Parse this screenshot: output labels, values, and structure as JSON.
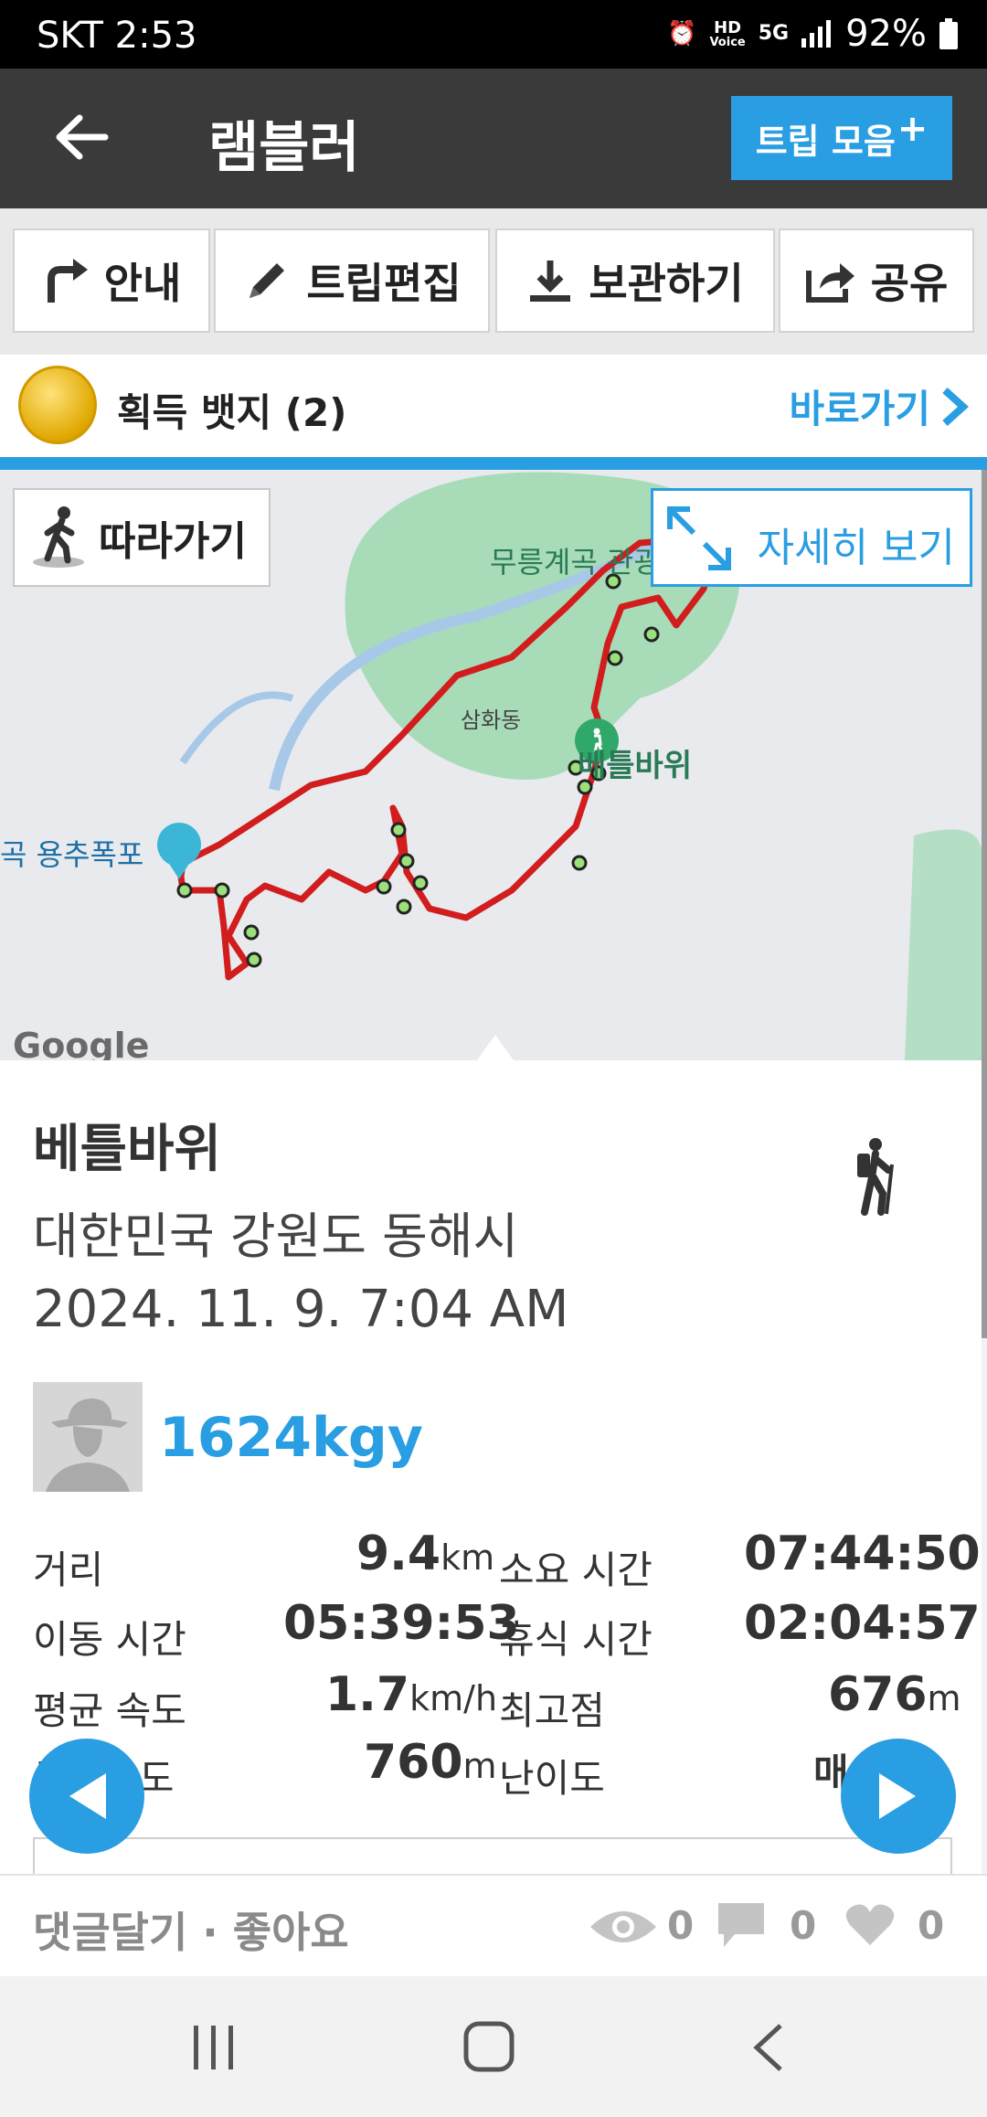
{
  "status_bar": {
    "carrier_time": "SKT 2:53",
    "battery": "92%",
    "hd_label": "HD",
    "voice_label": "Voice",
    "network": "5G"
  },
  "app_bar": {
    "title": "램블러",
    "trip_collection_label": "트립 모음",
    "trip_collection_plus": "+"
  },
  "toolbar": {
    "guide": "안내",
    "edit_trip": "트립편집",
    "save": "보관하기",
    "share": "공유"
  },
  "badges": {
    "label": "획득 뱃지 (2)",
    "goto_label": "바로가기"
  },
  "map": {
    "follow_label": "따라가기",
    "detail_label": "자세히 보기",
    "place_valley": "무릉계곡 관광",
    "place_village": "삼화동",
    "place_rock": "베틀바위",
    "place_waterfall": "곡 용추폭포",
    "logo": "Google"
  },
  "trip": {
    "name": "베틀바위",
    "location": "대한민국 강원도 동해시",
    "datetime": "2024. 11. 9. 7:04 AM",
    "user": "1624kgy"
  },
  "stats": {
    "distance_label": "거리",
    "distance_value": "9.4",
    "distance_unit": "km",
    "duration_label": "소요 시간",
    "duration_value": "07:44:50",
    "moving_label": "이동 시간",
    "moving_value": "05:39:53",
    "rest_label": "휴식 시간",
    "rest_value": "02:04:57",
    "speed_label": "평균 속도",
    "speed_value": "1.7",
    "speed_unit": "km/h",
    "max_alt_label": "최고점",
    "max_alt_value": "676",
    "max_alt_unit": "m",
    "elev_label": "누적고도",
    "elev_value": "760",
    "elev_unit": "m",
    "difficulty_label": "난이도",
    "difficulty_value": "매우"
  },
  "comment_bar": {
    "label": "댓글달기 · 좋아요",
    "views": "0",
    "comments": "0",
    "likes": "0"
  },
  "colors": {
    "accent": "#2a9ee2",
    "appbar": "#3a3a3a",
    "route": "#d11d1d",
    "park": "#a8dcb9"
  }
}
